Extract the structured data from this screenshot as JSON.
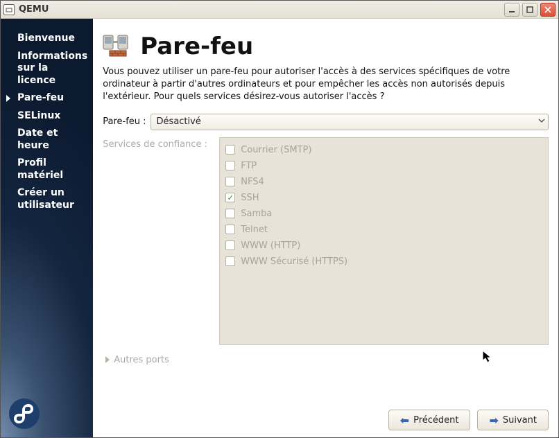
{
  "window": {
    "title": "QEMU"
  },
  "sidebar": {
    "items": [
      {
        "label": "Bienvenue",
        "active": false
      },
      {
        "label": "Informations sur la licence",
        "active": false
      },
      {
        "label": "Pare-feu",
        "active": true
      },
      {
        "label": "SELinux",
        "active": false
      },
      {
        "label": "Date et heure",
        "active": false
      },
      {
        "label": "Profil matériel",
        "active": false
      },
      {
        "label": "Créer un utilisateur",
        "active": false
      }
    ]
  },
  "content": {
    "heading": "Pare-feu",
    "description": "Vous pouvez utiliser un pare-feu pour autoriser l'accès à des services spécifiques de votre ordinateur à partir d'autres ordinateurs et pour empêcher les accès non autorisés depuis l'extérieur. Pour quels services désirez-vous autoriser l'accès ?",
    "dropdown": {
      "label": "Pare-feu :",
      "value": "Désactivé"
    },
    "services_label": "Services de confiance :",
    "services": [
      {
        "label": "Courrier (SMTP)",
        "checked": false
      },
      {
        "label": "FTP",
        "checked": false
      },
      {
        "label": "NFS4",
        "checked": false
      },
      {
        "label": "SSH",
        "checked": true
      },
      {
        "label": "Samba",
        "checked": false
      },
      {
        "label": "Telnet",
        "checked": false
      },
      {
        "label": "WWW (HTTP)",
        "checked": false
      },
      {
        "label": "WWW Sécurisé (HTTPS)",
        "checked": false
      }
    ],
    "other_ports": "Autres ports"
  },
  "footer": {
    "prev": "Précédent",
    "next": "Suivant"
  }
}
